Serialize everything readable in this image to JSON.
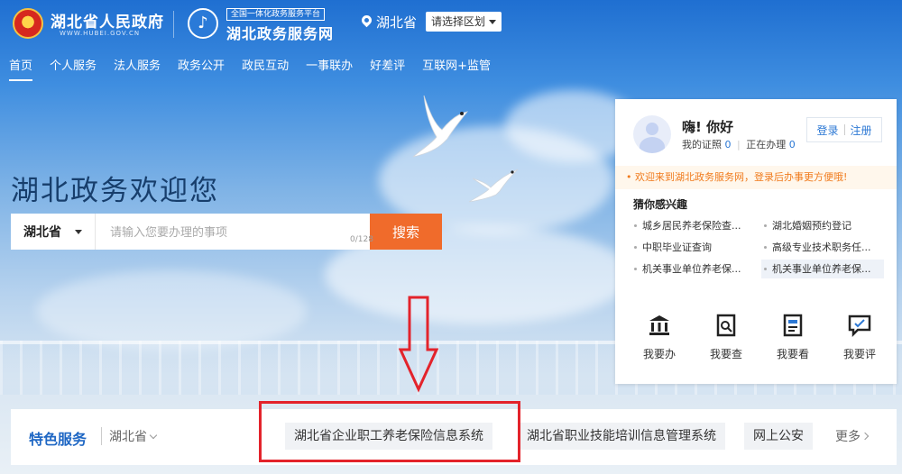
{
  "header": {
    "gov_title": "湖北省人民政府",
    "gov_url": "WWW.HUBEI.GOV.CN",
    "service_tag": "全国一体化政务服务平台",
    "service_title": "湖北政务服务网",
    "region": "湖北省",
    "region_select": "请选择区划"
  },
  "nav": [
    "首页",
    "个人服务",
    "法人服务",
    "政务公开",
    "政民互动",
    "一事联办",
    "好差评",
    "互联网+监管"
  ],
  "hero": {
    "welcome": "湖北政务欢迎您",
    "search_region": "湖北省",
    "search_placeholder": "请输入您要办理的事项",
    "search_counter": "0/128",
    "search_button": "搜索"
  },
  "panel": {
    "greeting": "嗨! 你好",
    "certs_label": "我的证照",
    "certs_count": "0",
    "processing_label": "正在办理",
    "processing_count": "0",
    "login": "登录",
    "register": "注册",
    "notice": "欢迎来到湖北政务服务网，登录后办事更方便哦!",
    "interest_title": "猜你感兴趣",
    "interests": [
      "城乡居民养老保险查...",
      "湖北婚姻预约登记",
      "中职毕业证查询",
      "高级专业技术职务任...",
      "机关事业单位养老保...",
      "机关事业单位养老保..."
    ],
    "quick": [
      {
        "label": "我要办",
        "icon": "bank-icon"
      },
      {
        "label": "我要查",
        "icon": "search-doc-icon"
      },
      {
        "label": "我要看",
        "icon": "view-doc-icon"
      },
      {
        "label": "我要评",
        "icon": "comment-icon"
      }
    ]
  },
  "bottom": {
    "title": "特色服务",
    "region": "湖北省",
    "services": [
      "湖北省企业职工养老保险信息系统",
      "湖北省职业技能培训信息管理系统",
      "网上公安"
    ],
    "more": "更多"
  },
  "colors": {
    "accent": "#2c78d4",
    "search_button": "#f06b2b",
    "highlight_box": "#e3232b"
  }
}
